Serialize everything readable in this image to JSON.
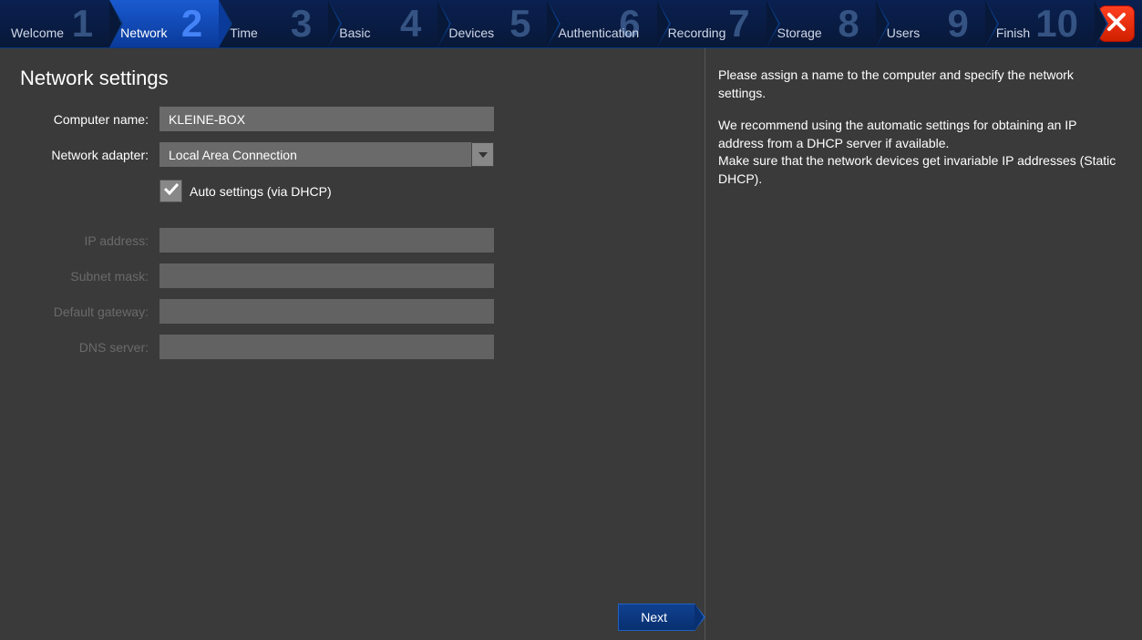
{
  "steps": [
    {
      "num": "1",
      "label": "Welcome"
    },
    {
      "num": "2",
      "label": "Network"
    },
    {
      "num": "3",
      "label": "Time"
    },
    {
      "num": "4",
      "label": "Basic"
    },
    {
      "num": "5",
      "label": "Devices"
    },
    {
      "num": "6",
      "label": "Authentication"
    },
    {
      "num": "7",
      "label": "Recording"
    },
    {
      "num": "8",
      "label": "Storage"
    },
    {
      "num": "9",
      "label": "Users"
    },
    {
      "num": "10",
      "label": "Finish"
    }
  ],
  "active_step": 1,
  "page_title": "Network settings",
  "form": {
    "computer_name_label": "Computer name:",
    "computer_name_value": "KLEINE-BOX",
    "adapter_label": "Network adapter:",
    "adapter_value": "Local Area Connection",
    "auto_label": "Auto settings (via DHCP)",
    "auto_checked": true,
    "ip_label": "IP address:",
    "ip_value": "",
    "mask_label": "Subnet mask:",
    "mask_value": "",
    "gateway_label": "Default gateway:",
    "gateway_value": "",
    "dns_label": "DNS server:",
    "dns_value": ""
  },
  "next_label": "Next",
  "help": {
    "p1": "Please assign a name to the computer and specify the network settings.",
    "p2": "We recommend using the automatic settings for obtaining an IP address from a DHCP server if available.",
    "p3": "Make sure that the network devices get invariable IP addresses (Static DHCP)."
  }
}
